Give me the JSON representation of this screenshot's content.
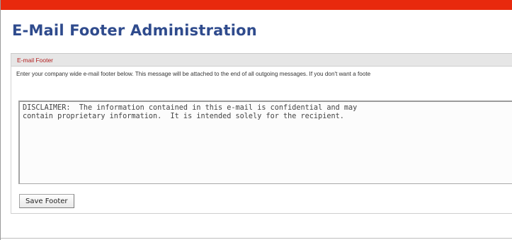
{
  "colors": {
    "top_bar": "#e8290d",
    "title": "#2f4b8d",
    "section_header_text": "#b32020",
    "section_header_bg": "#e6e6e6"
  },
  "page": {
    "title": "E-Mail Footer Administration"
  },
  "panel": {
    "header": "E-mail Footer",
    "description": "Enter your company wide e-mail footer below. This message will be attached to the end of all outgoing messages. If you don't want a foote",
    "footer_text": "DISCLAIMER:  The information contained in this e-mail is confidential and may\ncontain proprietary information.  It is intended solely for the recipient.",
    "save_label": "Save Footer"
  }
}
